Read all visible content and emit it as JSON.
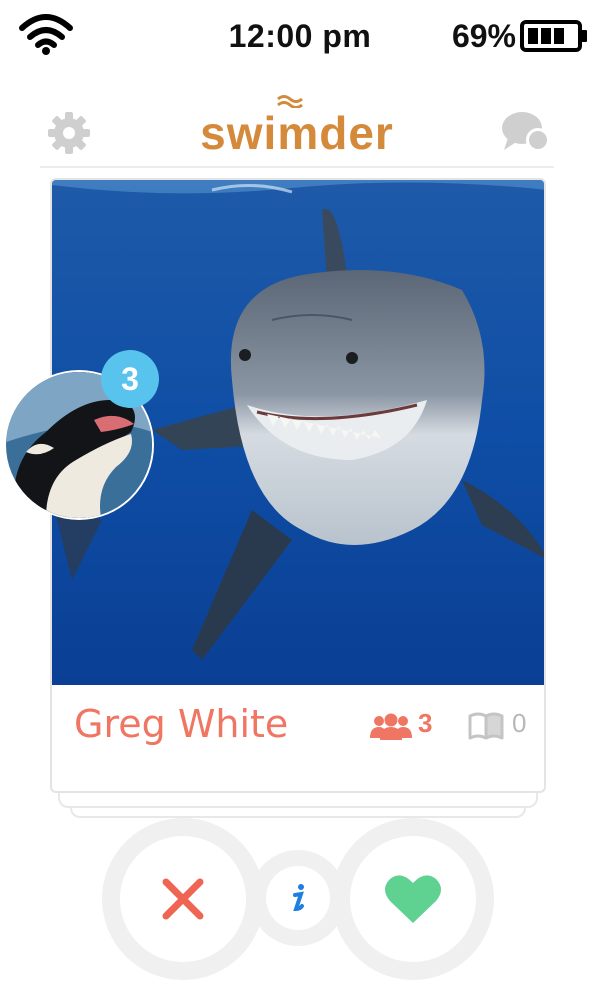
{
  "status": {
    "time": "12:00 pm",
    "battery": "69%"
  },
  "app": {
    "title": "swimder"
  },
  "profile": {
    "name": "Greg White",
    "friends_count": "3",
    "books_count": "0"
  },
  "match": {
    "badge_count": "3"
  },
  "icons": {
    "wifi": "wifi-icon",
    "battery": "battery-icon",
    "settings": "gear-icon",
    "messages": "chat-icon",
    "friends": "friends-icon",
    "books": "book-icon",
    "dislike": "close-icon",
    "info": "info-icon",
    "like": "heart-icon"
  },
  "colors": {
    "brand": "#d48a3a",
    "name": "#ef7663",
    "badge": "#58c3ec",
    "dislike": "#ee6554",
    "like": "#5fd191",
    "info": "#1f7fe0",
    "muted": "#c8c8c8"
  }
}
